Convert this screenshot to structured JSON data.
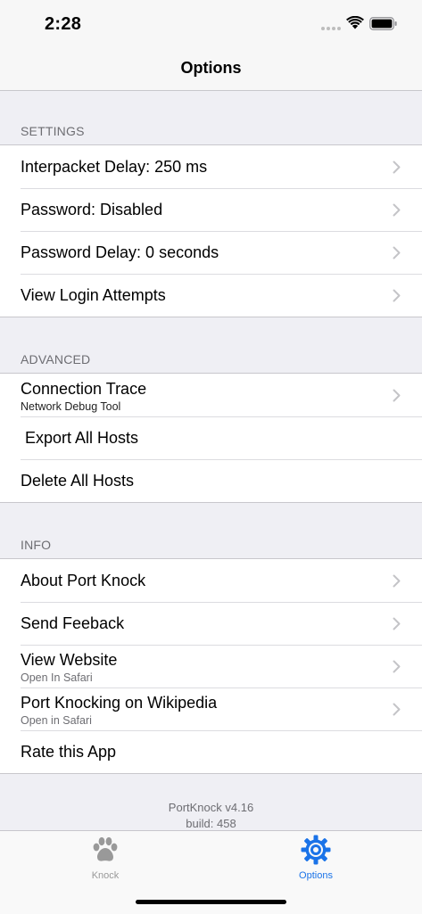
{
  "status_bar": {
    "time": "2:28"
  },
  "nav": {
    "title": "Options"
  },
  "sections": {
    "settings": {
      "header": "SETTINGS",
      "rows": [
        {
          "label": "Interpacket Delay: 250 ms"
        },
        {
          "label": "Password: Disabled"
        },
        {
          "label": "Password Delay: 0 seconds"
        },
        {
          "label": "View Login Attempts"
        }
      ]
    },
    "advanced": {
      "header": "ADVANCED",
      "rows": [
        {
          "label": "Connection Trace",
          "sub": "Network Debug Tool"
        },
        {
          "label": "Export All Hosts"
        },
        {
          "label": "Delete All Hosts"
        }
      ]
    },
    "info": {
      "header": "INFO",
      "rows": [
        {
          "label": "About Port Knock"
        },
        {
          "label": "Send Feeback"
        },
        {
          "label": "View Website",
          "sub": "Open In Safari"
        },
        {
          "label": "Port Knocking on Wikipedia",
          "sub": "Open in Safari"
        },
        {
          "label": "Rate this App"
        }
      ]
    }
  },
  "footer": {
    "version": "PortKnock v4.16",
    "build": "build: 458"
  },
  "tabs": [
    {
      "label": "Knock",
      "icon": "paw-icon"
    },
    {
      "label": "Options",
      "icon": "gear-icon"
    }
  ],
  "colors": {
    "accent": "#1a73e8",
    "inactive": "#999999",
    "background": "#efeff4"
  }
}
